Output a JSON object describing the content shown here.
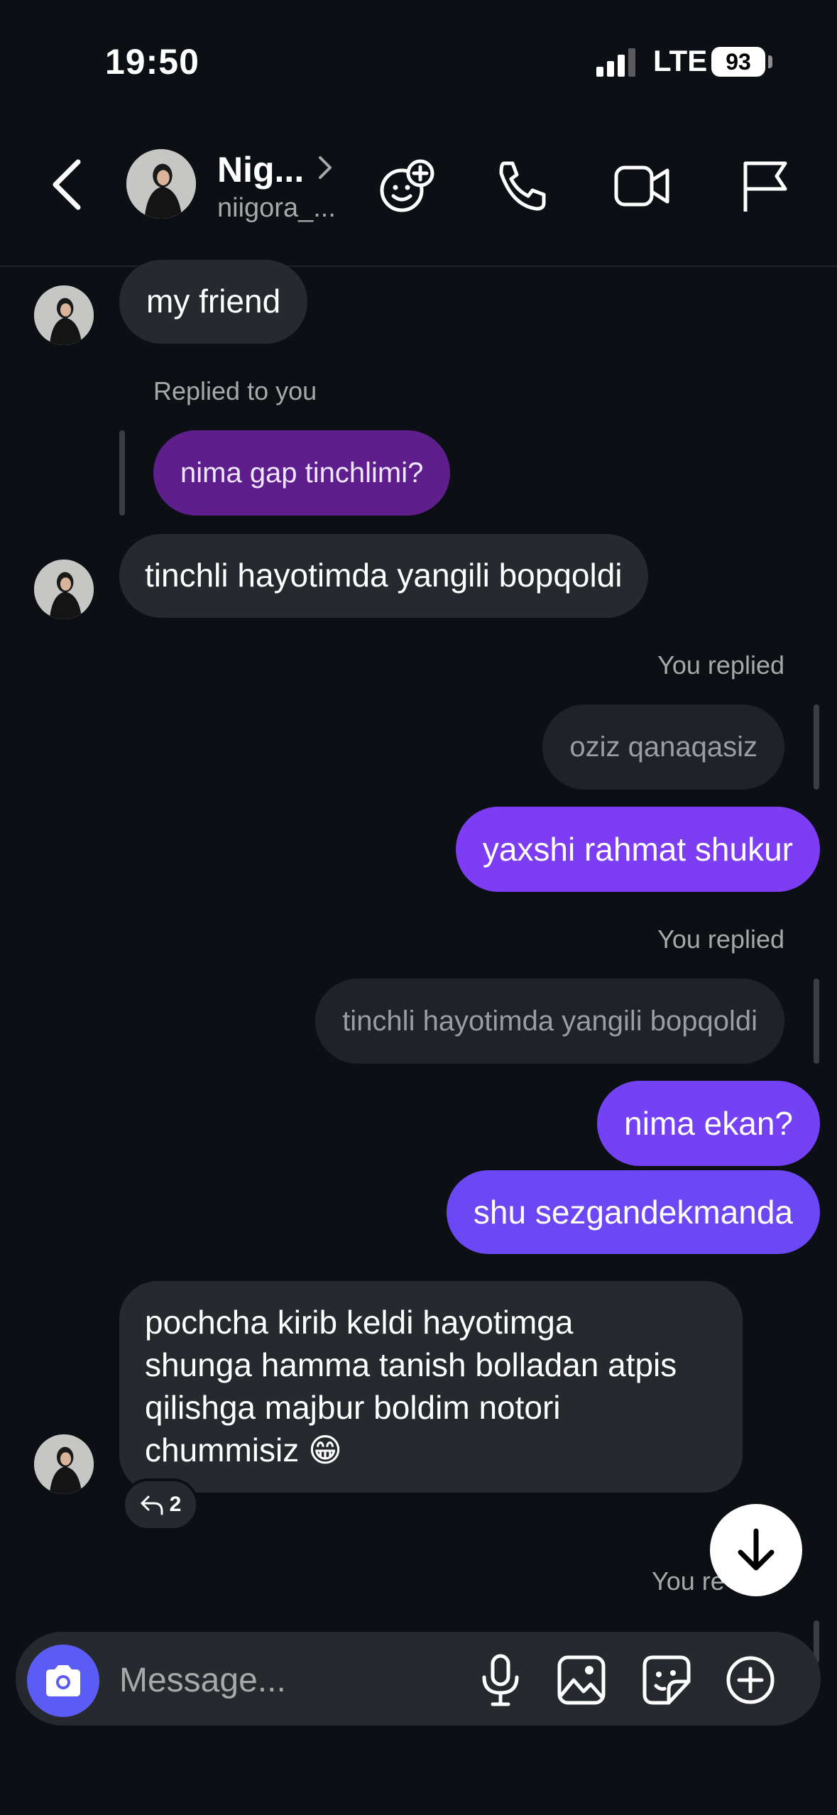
{
  "status_bar": {
    "time": "19:50",
    "network": "LTE",
    "battery": "93"
  },
  "header": {
    "name": "Nig...",
    "username": "niigora_..."
  },
  "messages": {
    "m1": "my friend",
    "reply_label_1": "Replied to you",
    "quote_1": "nima gap tinchlimi?",
    "m2": "tinchli hayotimda yangili bopqoldi",
    "reply_label_2": "You replied",
    "quote_2": "oziz qanaqasiz",
    "m3": "yaxshi rahmat shukur",
    "reply_label_3": "You replied",
    "quote_3": "tinchli hayotimda yangili bopqoldi",
    "m4": "nima ekan?",
    "m5": "shu sezgandekmanda",
    "m6_line1": "pochcha kirib keldi hayotimga",
    "m6_line2": "shunga hamma tanish bolladan atpis",
    "m6_line3": "qilishga majbur boldim notori",
    "m6_line4": "chummisiz 😁",
    "reaction_count": "2",
    "reply_label_4": "You re"
  },
  "composer": {
    "placeholder": "Message..."
  },
  "colors": {
    "background": "#0c1014",
    "incoming": "#262a2f",
    "outgoing": "#7a3cf0",
    "camera": "#5b5bf6"
  }
}
